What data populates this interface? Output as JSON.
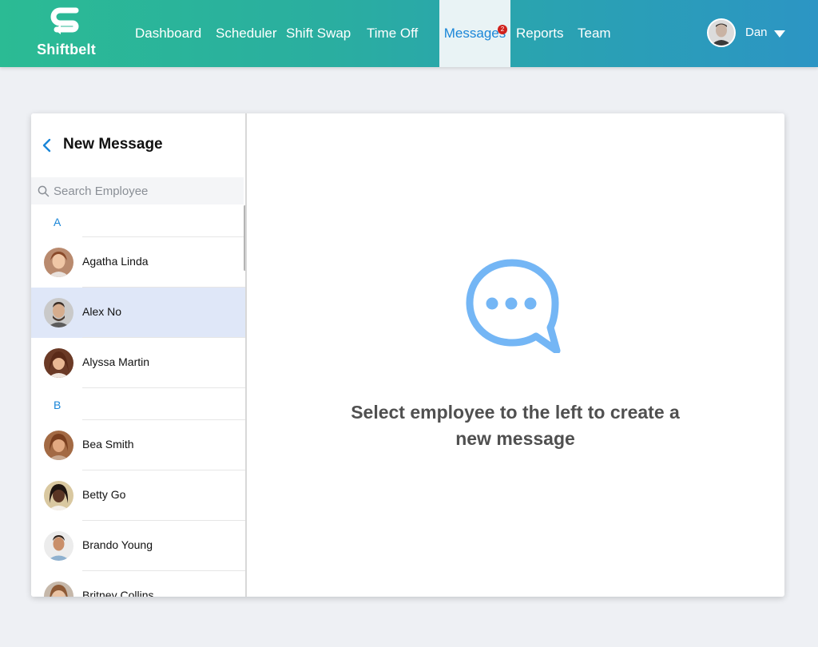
{
  "brand": {
    "name": "Shiftbelt"
  },
  "nav": {
    "items": [
      {
        "label": "Dashboard"
      },
      {
        "label": "Scheduler"
      },
      {
        "label": "Shift Swap"
      },
      {
        "label": "Time Off"
      },
      {
        "label": "Messages",
        "active": true,
        "badge": "2"
      },
      {
        "label": "Reports"
      },
      {
        "label": "Team"
      }
    ]
  },
  "user": {
    "name": "Dan"
  },
  "panel": {
    "title": "New Message",
    "search_placeholder": "Search Employee",
    "sections": [
      {
        "letter": "A",
        "employees": [
          "Agatha Linda",
          "Alex No",
          "Alyssa Martin"
        ]
      },
      {
        "letter": "B",
        "employees": [
          "Bea Smith",
          "Betty Go",
          "Brando Young",
          "Britney Collins"
        ]
      }
    ],
    "selected": "Alex No"
  },
  "empty_state": {
    "line1": "Select employee to the left to create a",
    "line2": "new message"
  },
  "colors": {
    "accent": "#1a86d8",
    "header_gradient_start": "#2bbb94",
    "header_gradient_end": "#2c95c4",
    "chat_icon": "#74b6f5",
    "badge": "#d0211c",
    "selected_row": "#dfe7f8"
  }
}
